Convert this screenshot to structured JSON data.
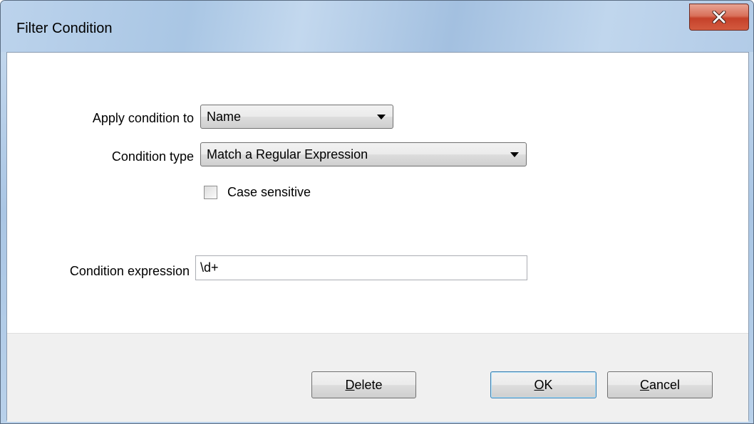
{
  "window": {
    "title": "Filter Condition"
  },
  "form": {
    "apply_condition_label": "Apply condition to",
    "apply_condition_value": "Name",
    "condition_type_label": "Condition type",
    "condition_type_value": "Match a Regular Expression",
    "case_sensitive_label": "Case sensitive",
    "case_sensitive_checked": false,
    "condition_expression_label": "Condition expression",
    "condition_expression_value": "\\d+"
  },
  "buttons": {
    "delete_mnemonic": "D",
    "delete_rest": "elete",
    "ok_mnemonic": "O",
    "ok_rest": "K",
    "cancel_mnemonic": "C",
    "cancel_rest": "ancel"
  },
  "icons": {
    "close": "close-icon"
  }
}
